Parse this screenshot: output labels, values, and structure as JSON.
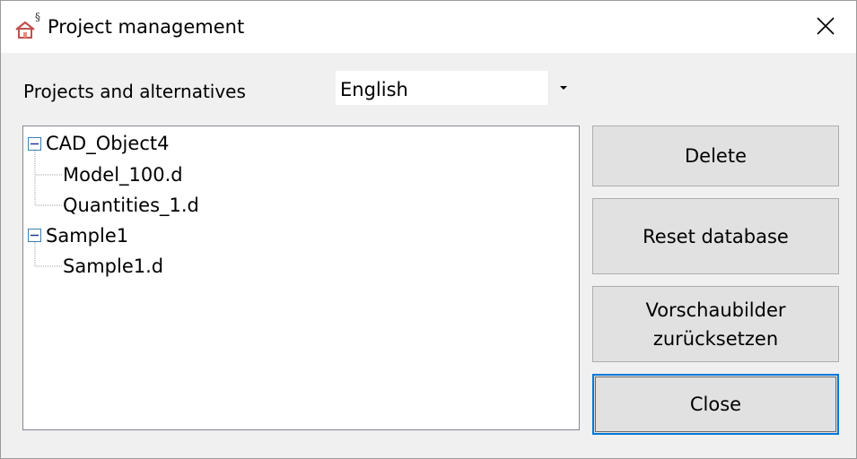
{
  "window": {
    "title": "Project management",
    "app_icon": "house-section-icon",
    "close_icon": "close-icon"
  },
  "main": {
    "projects_label": "Projects and alternatives",
    "language": {
      "selected": "English",
      "dropdown_icon": "caret-down-icon"
    },
    "tree": {
      "projects": [
        {
          "name": "CAD_Object4",
          "expanded": true,
          "alternatives": [
            "Model_100.d",
            "Quantities_1.d"
          ]
        },
        {
          "name": "Sample1",
          "expanded": true,
          "alternatives": [
            "Sample1.d"
          ]
        }
      ]
    }
  },
  "buttons": {
    "delete": "Delete",
    "reset_database": "Reset database",
    "reset_previews": "Vorschaubilder\nzurücksetzen",
    "close": "Close"
  },
  "colors": {
    "accent": "#0078d7",
    "expander_box": "#3c7fb1"
  }
}
